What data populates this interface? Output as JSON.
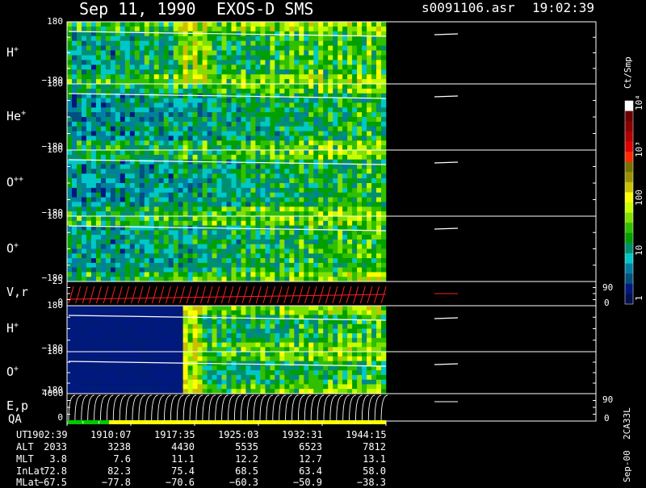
{
  "header": {
    "date": "Sep 11, 1990",
    "instrument": "EXOS-D SMS",
    "file": "s0091106.asr",
    "time": "19:02:39"
  },
  "colorbar": {
    "unit": "Ct/Smp",
    "labels": [
      "10⁴",
      "10³",
      "100",
      "10",
      "1"
    ],
    "colors": [
      "#ffffff",
      "#6a0000",
      "#8b0000",
      "#b00000",
      "#e00000",
      "#ff2a00",
      "#7a7000",
      "#9a9000",
      "#c8c000",
      "#ffff00",
      "#c8ff00",
      "#80e000",
      "#30c000",
      "#00a000",
      "#009070",
      "#00c8c8",
      "#0080a0",
      "#005080",
      "#001880",
      "#001050"
    ]
  },
  "panels": [
    {
      "label": "H",
      "charge": "+",
      "ymax": "180",
      "ymin": "−180",
      "type": "spectro"
    },
    {
      "label": "He",
      "charge": "+",
      "ymax": "180",
      "ymin": "−180",
      "type": "spectro"
    },
    {
      "label": "O",
      "charge": "++",
      "ymax": "180",
      "ymin": "−180",
      "type": "spectro"
    },
    {
      "label": "O",
      "charge": "+",
      "ymax": "180",
      "ymin": "−180",
      "type": "spectro"
    },
    {
      "label": "V,r",
      "charge": "",
      "ymax": "25",
      "ymin": "0",
      "right_top": "90",
      "right_bottom": "0",
      "type": "vr"
    },
    {
      "label": "H",
      "charge": "+",
      "ymax": "180",
      "ymin": "−180",
      "type": "spectro"
    },
    {
      "label": "O",
      "charge": "+",
      "ymax": "180",
      "ymin": "−180",
      "type": "spectro"
    },
    {
      "label": "E,p",
      "charge": "",
      "ymax": "4000",
      "ymin": "0",
      "right_top": "90",
      "right_bottom": "0",
      "type": "ep"
    }
  ],
  "qa_label": "QA",
  "qa_colors": [
    "#00c800",
    "#ffff00"
  ],
  "side_label": "Sep-00  2CA33L",
  "ephemeris": {
    "row_labels": [
      "UT",
      "ALT",
      "MLT",
      "InLat",
      "MLat"
    ],
    "columns": [
      [
        "1902:39",
        "2033",
        "3.8",
        "72.8",
        "−67.5"
      ],
      [
        "1910:07",
        "3238",
        "7.6",
        "82.3",
        "−77.8"
      ],
      [
        "1917:35",
        "4430",
        "11.1",
        "75.4",
        "−70.6"
      ],
      [
        "1925:03",
        "5535",
        "12.2",
        "68.5",
        "−60.3"
      ],
      [
        "1932:31",
        "6523",
        "12.7",
        "63.4",
        "−50.9"
      ],
      [
        "1944:15",
        "7812",
        "13.1",
        "58.0",
        "−38.3"
      ]
    ]
  },
  "chart_data": {
    "type": "heatmap",
    "title": "Sep 11, 1990   EXOS-D SMS",
    "x_ticks": [
      "1902:39",
      "1910:07",
      "1917:35",
      "1925:03",
      "1932:31",
      "1944:15"
    ],
    "panels": [
      "H+",
      "He+",
      "O++",
      "O+",
      "V,r",
      "H+",
      "O+",
      "E,p"
    ],
    "y_range_pitch": [
      -180,
      180
    ],
    "y_range_V": [
      0,
      25
    ],
    "y_range_E": [
      0,
      4000
    ],
    "colorbar_range": [
      1,
      10000
    ],
    "colorbar_scale": "log",
    "legend": "right"
  }
}
